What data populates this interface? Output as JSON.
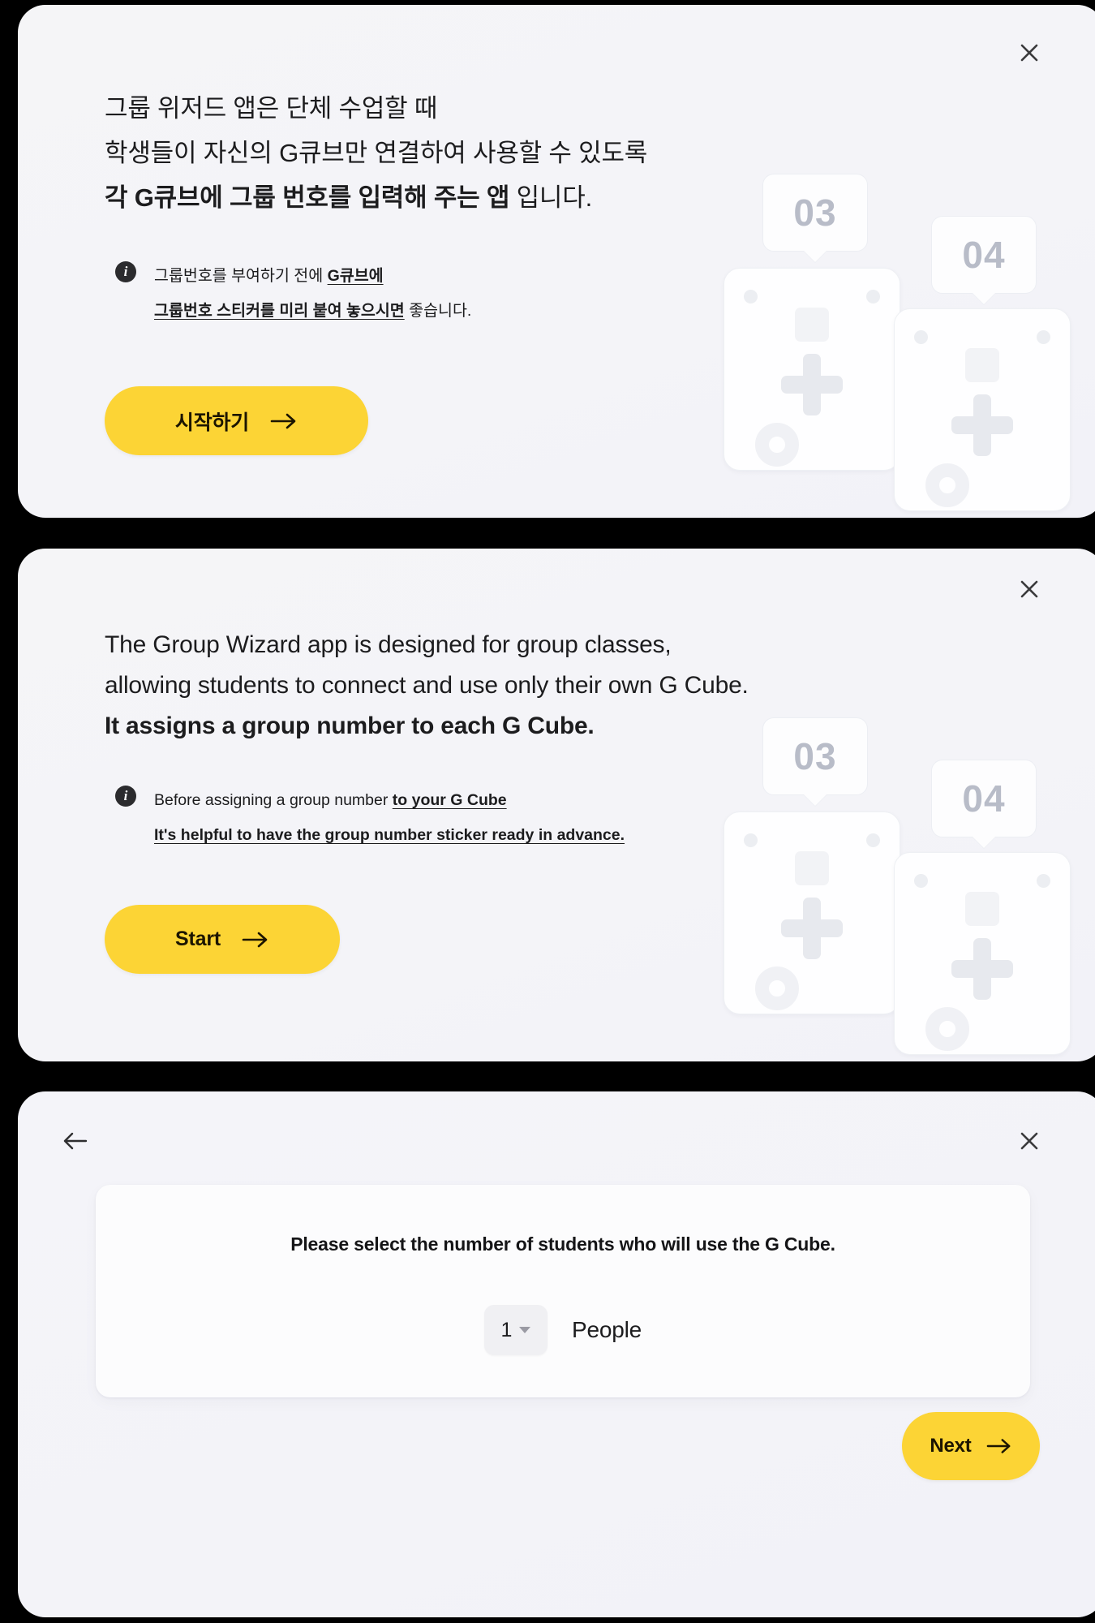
{
  "panels": {
    "korean": {
      "headline_line1": "그룹 위저드 앱은 단체 수업할 때",
      "headline_line2": "학생들이 자신의 G큐브만 연결하여 사용할 수 있도록",
      "headline_line3_bold": "각 G큐브에 그룹 번호를 입력해 주는 앱",
      "headline_line3_tail": " 입니다.",
      "note_icon": "info-icon",
      "note_line1_plain": "그룹번호를 부여하기 전에 ",
      "note_line1_emph": "G큐브에",
      "note_line2_emph": "그룹번호 스티커를 미리 붙여 놓으시면",
      "note_line2_plain": " 좋습니다.",
      "cta_label": "시작하기",
      "cta_arrow": "arrow-right-icon",
      "close_icon": "close-icon"
    },
    "english": {
      "headline_line1": "The Group Wizard app is designed for group classes,",
      "headline_line2": "allowing students to connect and use only their own G Cube.",
      "headline_line3_bold": "It assigns a group number to each G Cube.",
      "note_icon": "info-icon",
      "note_line1_plain": "Before assigning a group number ",
      "note_line1_emph": "to your G Cube",
      "note_line2_emph": "It's helpful to have the group number sticker ready in advance.",
      "cta_label": "Start",
      "cta_arrow": "arrow-right-icon",
      "close_icon": "close-icon"
    },
    "selector": {
      "back_icon": "arrow-left-icon",
      "close_icon": "close-icon",
      "title": "Please select the number of students who will use the G Cube.",
      "count_value": "1",
      "count_caret": "chevron-down-icon",
      "unit_label": "People",
      "next_label": "Next",
      "next_arrow": "arrow-right-icon"
    }
  },
  "illustration": {
    "bubble_a": "03",
    "bubble_b": "04"
  },
  "colors": {
    "accent_yellow": "#FCD435",
    "panel_bg": "#F4F4F8",
    "card_bg": "#FCFCFD",
    "text_primary": "#1C1C1E",
    "bubble_number": "#B8BCC8",
    "backdrop": "#000000"
  }
}
